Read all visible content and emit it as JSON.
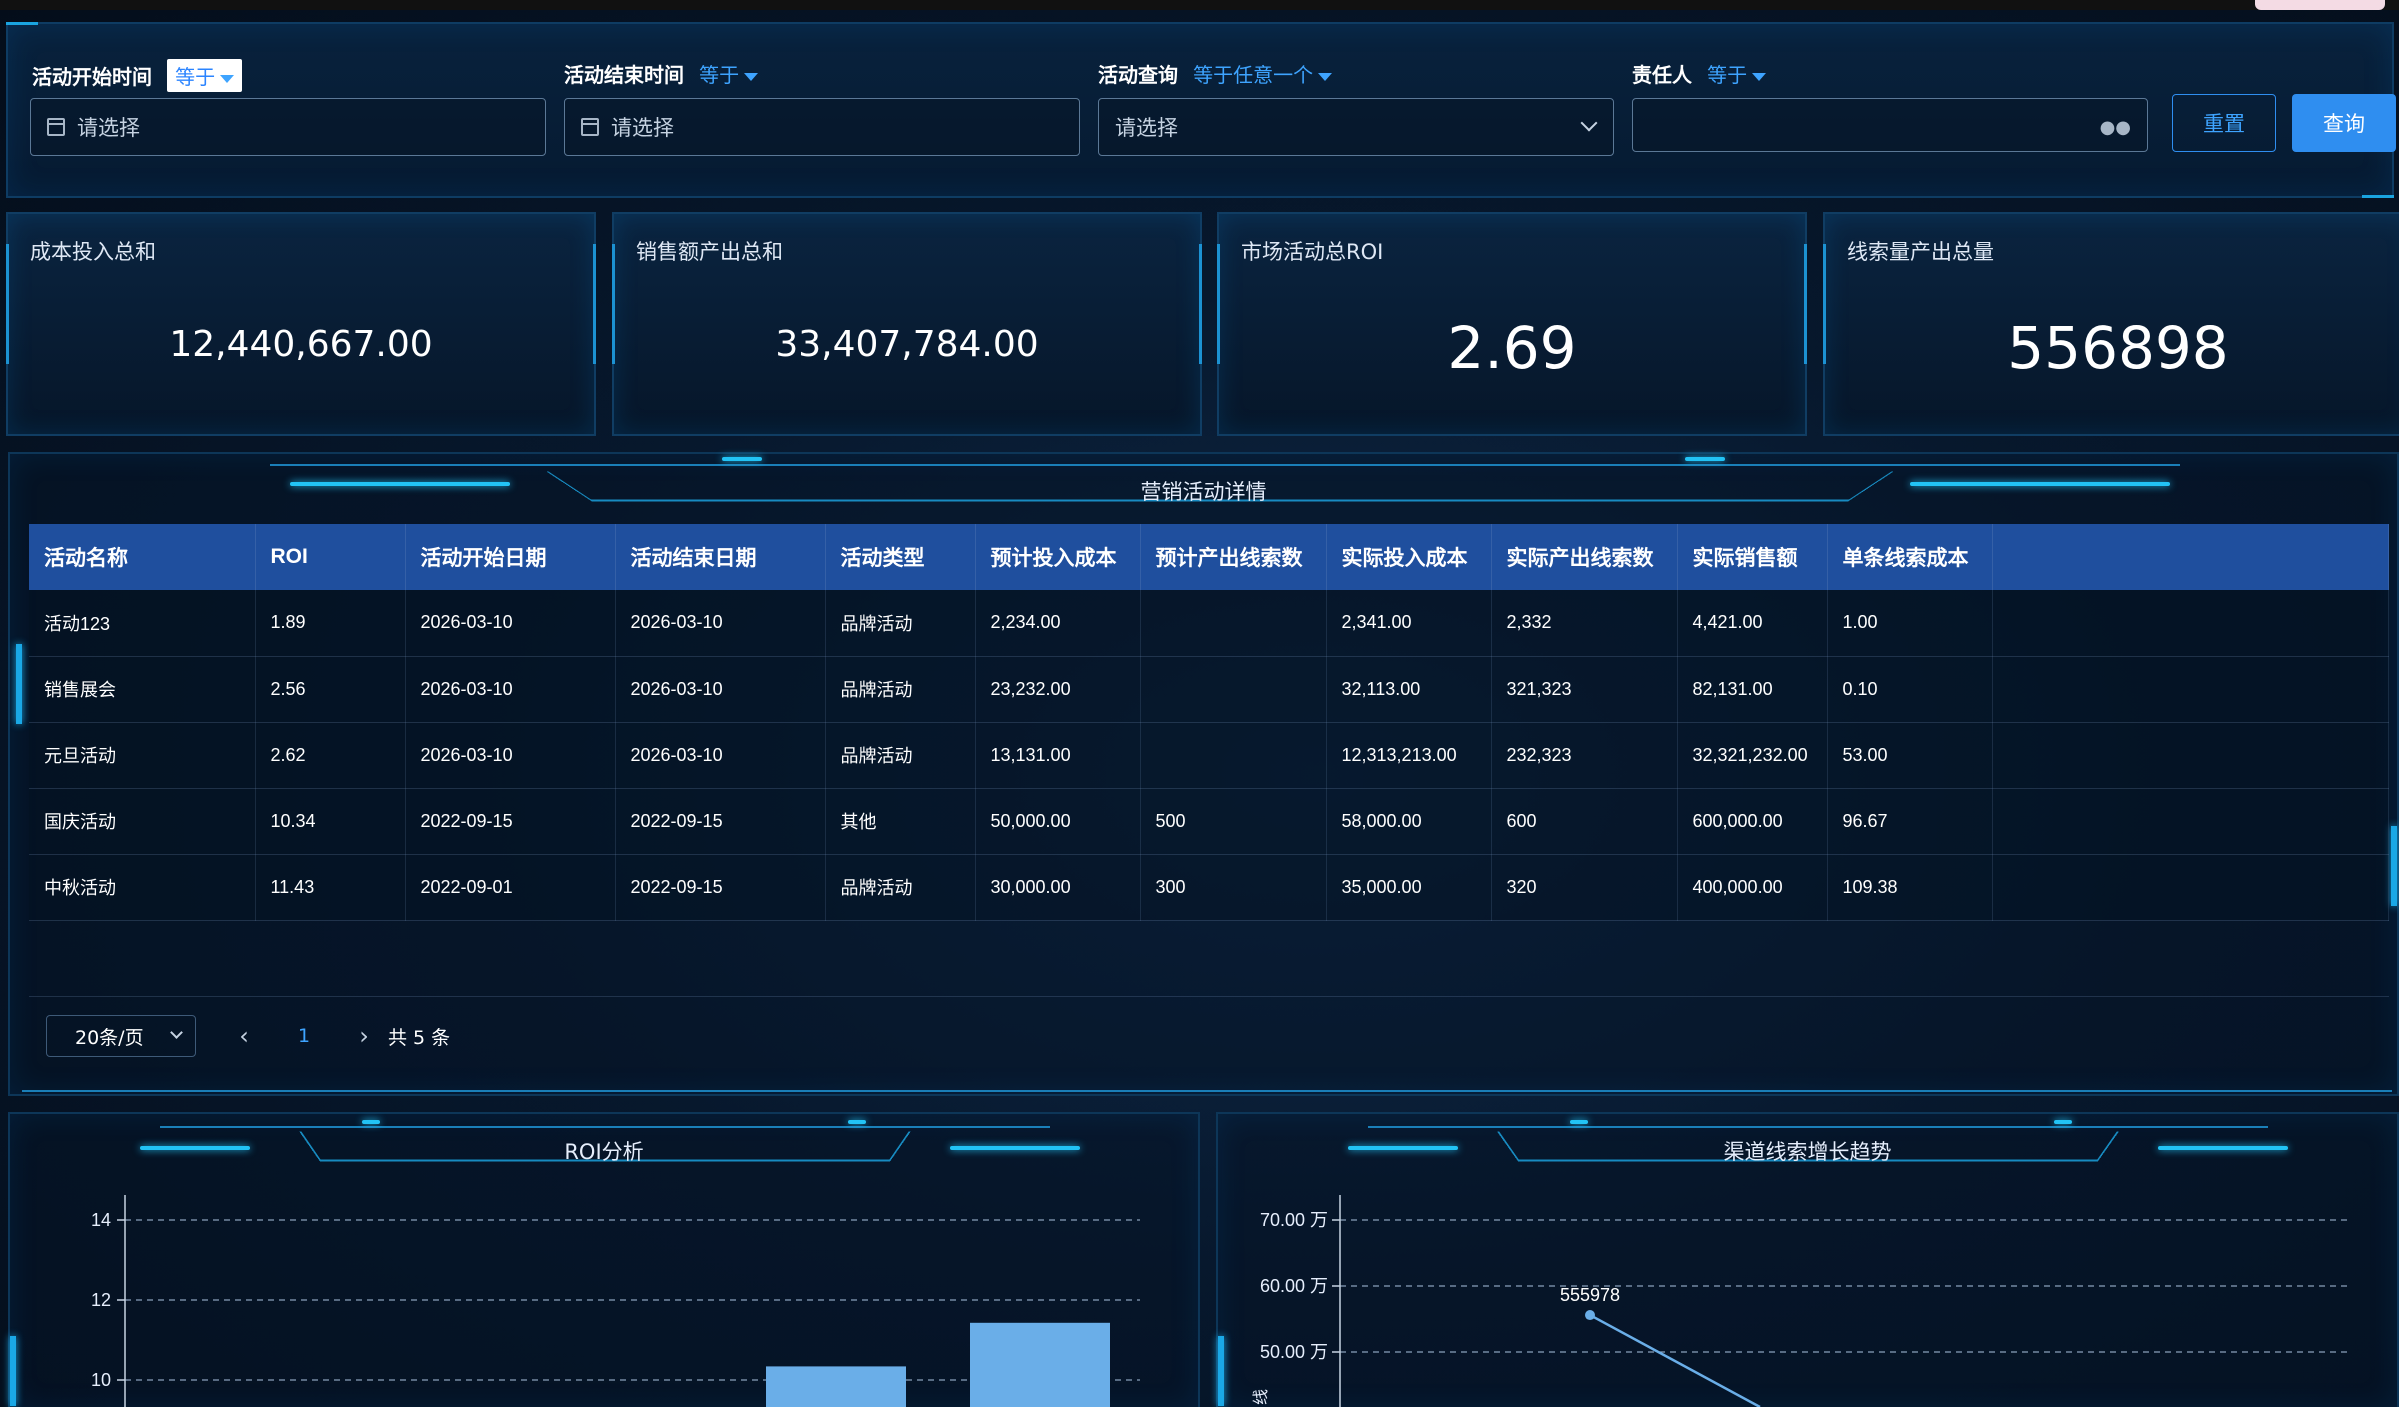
{
  "filters": {
    "start_time": {
      "label": "活动开始时间",
      "operator": "等于",
      "placeholder": "请选择"
    },
    "end_time": {
      "label": "活动结束时间",
      "operator": "等于",
      "placeholder": "请选择"
    },
    "activity_query": {
      "label": "活动查询",
      "operator": "等于任意一个",
      "placeholder": "请选择"
    },
    "owner": {
      "label": "责任人",
      "operator": "等于",
      "placeholder": ""
    },
    "reset_label": "重置",
    "query_label": "查询"
  },
  "kpis": [
    {
      "title": "成本投入总和",
      "value": "12,440,667.00"
    },
    {
      "title": "销售额产出总和",
      "value": "33,407,784.00"
    },
    {
      "title": "市场活动总ROI",
      "value": "2.69"
    },
    {
      "title": "线索量产出总量",
      "value": "556898"
    }
  ],
  "detail_panel": {
    "title": "营销活动详情",
    "columns": [
      "活动名称",
      "ROI",
      "活动开始日期",
      "活动结束日期",
      "活动类型",
      "预计投入成本",
      "预计产出线索数",
      "实际投入成本",
      "实际产出线索数",
      "实际销售额",
      "单条线索成本"
    ],
    "rows": [
      [
        "活动123",
        "1.89",
        "2026-03-10",
        "2026-03-10",
        "品牌活动",
        "2,234.00",
        "",
        "2,341.00",
        "2,332",
        "4,421.00",
        "1.00"
      ],
      [
        "销售展会",
        "2.56",
        "2026-03-10",
        "2026-03-10",
        "品牌活动",
        "23,232.00",
        "",
        "32,113.00",
        "321,323",
        "82,131.00",
        "0.10"
      ],
      [
        "元旦活动",
        "2.62",
        "2026-03-10",
        "2026-03-10",
        "品牌活动",
        "13,131.00",
        "",
        "12,313,213.00",
        "232,323",
        "32,321,232.00",
        "53.00"
      ],
      [
        "国庆活动",
        "10.34",
        "2022-09-15",
        "2022-09-15",
        "其他",
        "50,000.00",
        "500",
        "58,000.00",
        "600",
        "600,000.00",
        "96.67"
      ],
      [
        "中秋活动",
        "11.43",
        "2022-09-01",
        "2022-09-15",
        "品牌活动",
        "30,000.00",
        "300",
        "35,000.00",
        "320",
        "400,000.00",
        "109.38"
      ]
    ],
    "pager": {
      "page_size": "20条/页",
      "prev": "‹",
      "current": "1",
      "next": "›",
      "total": "共 5 条"
    }
  },
  "roi_panel": {
    "title": "ROI分析"
  },
  "trend_panel": {
    "title": "渠道线索增长趋势"
  },
  "chart_data": [
    {
      "type": "bar",
      "title": "ROI分析",
      "y_ticks": [
        "14",
        "12",
        "10"
      ],
      "ylim": [
        10,
        14
      ],
      "visible_values": [
        10.34,
        11.43
      ],
      "bar_color": "#6aaee8"
    },
    {
      "type": "line",
      "title": "渠道线索增长趋势",
      "y_ticks": [
        "70.00 万",
        "60.00 万",
        "50.00 万"
      ],
      "ylim_wan": [
        50,
        70
      ],
      "ylabel": "线",
      "point_label": "555978",
      "points": [
        555978
      ],
      "line_color": "#6aaee8"
    }
  ]
}
